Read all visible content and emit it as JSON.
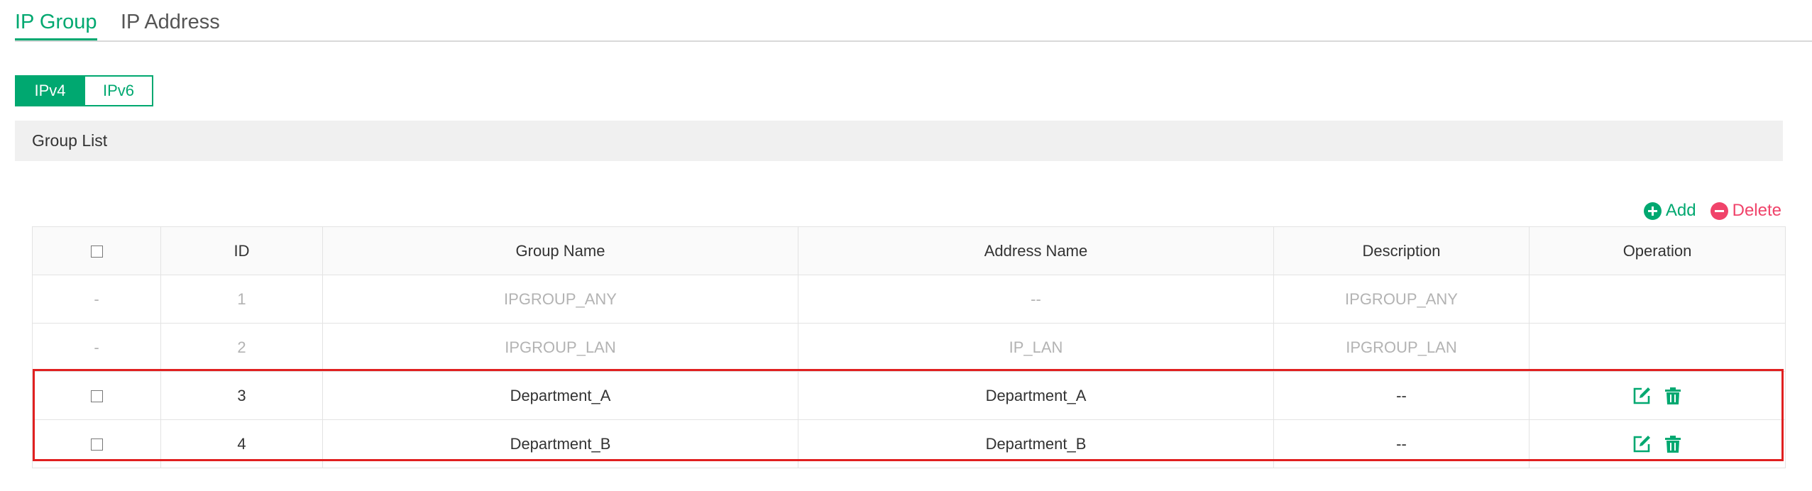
{
  "tabs": [
    {
      "label": "IP Group",
      "active": true
    },
    {
      "label": "IP Address",
      "active": false
    }
  ],
  "ip_version": {
    "options": [
      "IPv4",
      "IPv6"
    ],
    "selected": "IPv4"
  },
  "section": {
    "title": "Group List"
  },
  "actions": {
    "add_label": "Add",
    "delete_label": "Delete"
  },
  "table": {
    "columns": [
      "",
      "ID",
      "Group Name",
      "Address Name",
      "Description",
      "Operation"
    ],
    "rows": [
      {
        "select": "-",
        "id": "1",
        "group_name": "IPGROUP_ANY",
        "address_name": "--",
        "description": "IPGROUP_ANY"
      },
      {
        "select": "-",
        "id": "2",
        "group_name": "IPGROUP_LAN",
        "address_name": "IP_LAN",
        "description": "IPGROUP_LAN"
      },
      {
        "select": "",
        "id": "3",
        "group_name": "Department_A",
        "address_name": "Department_A",
        "description": "--"
      },
      {
        "select": "",
        "id": "4",
        "group_name": "Department_B",
        "address_name": "Department_B",
        "description": "--"
      }
    ]
  },
  "colors": {
    "accent": "#00a870",
    "danger": "#f0436a",
    "highlight": "#e02020"
  },
  "icons": {
    "edit": "edit-icon",
    "delete": "trash-icon",
    "add": "plus-circle-icon",
    "remove": "minus-circle-icon"
  }
}
